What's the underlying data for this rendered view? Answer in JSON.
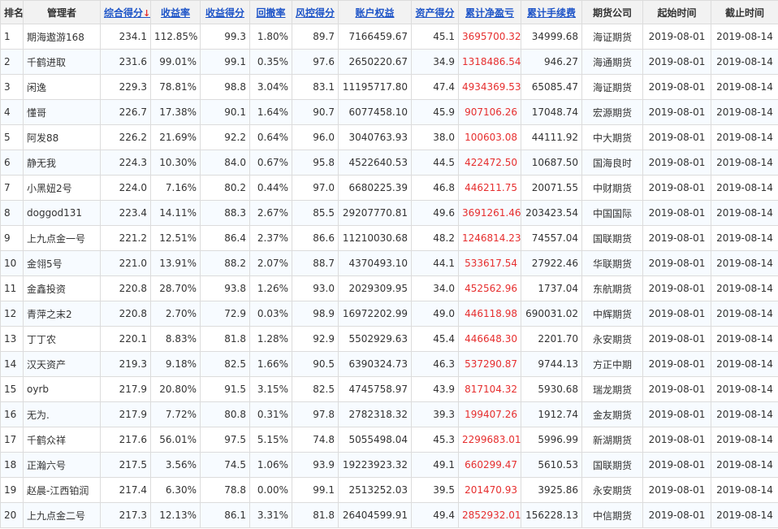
{
  "headers": {
    "rank": "排名",
    "manager": "管理者",
    "composite_score": "综合得分",
    "sort_arrow": "↓",
    "return_rate": "收益率",
    "return_score": "收益得分",
    "drawdown": "回撤率",
    "risk_score": "风控得分",
    "equity": "账户权益",
    "asset_score": "资产得分",
    "net_profit": "累计净盈亏",
    "fees": "累计手续费",
    "broker": "期货公司",
    "start_date": "起始时间",
    "end_date": "截止时间"
  },
  "rows": [
    [
      "1",
      "期海遨游168",
      "234.1",
      "112.85%",
      "99.3",
      "1.80%",
      "89.7",
      "7166459.67",
      "45.1",
      "3695700.32",
      "34999.68",
      "海证期货",
      "2019-08-01",
      "2019-08-14"
    ],
    [
      "2",
      "千鹤进取",
      "231.6",
      "99.01%",
      "99.1",
      "0.35%",
      "97.6",
      "2650220.67",
      "34.9",
      "1318486.54",
      "946.27",
      "海通期货",
      "2019-08-01",
      "2019-08-14"
    ],
    [
      "3",
      "闲逸",
      "229.3",
      "78.81%",
      "98.8",
      "3.04%",
      "83.1",
      "11195717.80",
      "47.4",
      "4934369.53",
      "65085.47",
      "海证期货",
      "2019-08-01",
      "2019-08-14"
    ],
    [
      "4",
      "懂哥",
      "226.7",
      "17.38%",
      "90.1",
      "1.64%",
      "90.7",
      "6077458.10",
      "45.9",
      "907106.26",
      "17048.74",
      "宏源期货",
      "2019-08-01",
      "2019-08-14"
    ],
    [
      "5",
      "阿发88",
      "226.2",
      "21.69%",
      "92.2",
      "0.64%",
      "96.0",
      "3040763.93",
      "38.0",
      "100603.08",
      "44111.92",
      "中大期货",
      "2019-08-01",
      "2019-08-14"
    ],
    [
      "6",
      "静无我",
      "224.3",
      "10.30%",
      "84.0",
      "0.67%",
      "95.8",
      "4522640.53",
      "44.5",
      "422472.50",
      "10687.50",
      "国海良时",
      "2019-08-01",
      "2019-08-14"
    ],
    [
      "7",
      "小黑妞2号",
      "224.0",
      "7.16%",
      "80.2",
      "0.44%",
      "97.0",
      "6680225.39",
      "46.8",
      "446211.75",
      "20071.55",
      "中财期货",
      "2019-08-01",
      "2019-08-14"
    ],
    [
      "8",
      "doggod131",
      "223.4",
      "14.11%",
      "88.3",
      "2.67%",
      "85.5",
      "29207770.81",
      "49.6",
      "3691261.46",
      "203423.54",
      "中国国际",
      "2019-08-01",
      "2019-08-14"
    ],
    [
      "9",
      "上九点金一号",
      "221.2",
      "12.51%",
      "86.4",
      "2.37%",
      "86.6",
      "11210030.68",
      "48.2",
      "1246814.23",
      "74557.04",
      "国联期货",
      "2019-08-01",
      "2019-08-14"
    ],
    [
      "10",
      "金翎5号",
      "221.0",
      "13.91%",
      "88.2",
      "2.07%",
      "88.7",
      "4370493.10",
      "44.1",
      "533617.54",
      "27922.46",
      "华联期货",
      "2019-08-01",
      "2019-08-14"
    ],
    [
      "11",
      "金鑫投资",
      "220.8",
      "28.70%",
      "93.8",
      "1.26%",
      "93.0",
      "2029309.95",
      "34.0",
      "452562.96",
      "1737.04",
      "东航期货",
      "2019-08-01",
      "2019-08-14"
    ],
    [
      "12",
      "青萍之末2",
      "220.8",
      "2.70%",
      "72.9",
      "0.03%",
      "98.9",
      "16972202.99",
      "49.0",
      "446118.98",
      "690031.02",
      "中辉期货",
      "2019-08-01",
      "2019-08-14"
    ],
    [
      "13",
      "丁丁农",
      "220.1",
      "8.83%",
      "81.8",
      "1.28%",
      "92.9",
      "5502929.63",
      "45.4",
      "446648.30",
      "2201.70",
      "永安期货",
      "2019-08-01",
      "2019-08-14"
    ],
    [
      "14",
      "汉天资产",
      "219.3",
      "9.18%",
      "82.5",
      "1.66%",
      "90.5",
      "6390324.73",
      "46.3",
      "537290.87",
      "9744.13",
      "方正中期",
      "2019-08-01",
      "2019-08-14"
    ],
    [
      "15",
      "oyrb",
      "217.9",
      "20.80%",
      "91.5",
      "3.15%",
      "82.5",
      "4745758.97",
      "43.9",
      "817104.32",
      "5930.68",
      "瑞龙期货",
      "2019-08-01",
      "2019-08-14"
    ],
    [
      "16",
      "无为.",
      "217.9",
      "7.72%",
      "80.8",
      "0.31%",
      "97.8",
      "2782318.32",
      "39.3",
      "199407.26",
      "1912.74",
      "金友期货",
      "2019-08-01",
      "2019-08-14"
    ],
    [
      "17",
      "千鹤众祥",
      "217.6",
      "56.01%",
      "97.5",
      "5.15%",
      "74.8",
      "5055498.04",
      "45.3",
      "2299683.01",
      "5996.99",
      "新湖期货",
      "2019-08-01",
      "2019-08-14"
    ],
    [
      "18",
      "正瀚六号",
      "217.5",
      "3.56%",
      "74.5",
      "1.06%",
      "93.9",
      "19223923.32",
      "49.1",
      "660299.47",
      "5610.53",
      "国联期货",
      "2019-08-01",
      "2019-08-14"
    ],
    [
      "19",
      "赵晨-江西铂润",
      "217.4",
      "6.30%",
      "78.8",
      "0.00%",
      "99.1",
      "2513252.03",
      "39.5",
      "201470.93",
      "3925.86",
      "永安期货",
      "2019-08-01",
      "2019-08-14"
    ],
    [
      "20",
      "上九点金二号",
      "217.3",
      "12.13%",
      "86.1",
      "3.31%",
      "81.8",
      "26404599.91",
      "49.4",
      "2852932.01",
      "156228.13",
      "中信期货",
      "2019-08-01",
      "2019-08-14"
    ]
  ]
}
